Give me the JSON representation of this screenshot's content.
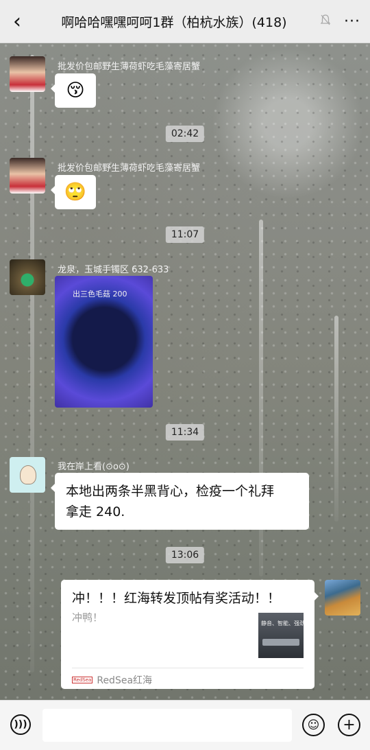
{
  "header": {
    "title": "啊哈哈嘿嘿呵呵1群（柏杭水族）(418)",
    "back_icon": "chevron-left-icon",
    "mute_icon": "bell-off-icon",
    "more_icon": "more-dots-icon"
  },
  "messages": [
    {
      "sender": "批发价包邮野生薄荷虾吃毛藻寄居蟹",
      "type": "emoji",
      "emoji": "😚"
    },
    {
      "timestamp": "02:42"
    },
    {
      "sender": "批发价包邮野生薄荷虾吃毛藻寄居蟹",
      "type": "emoji",
      "emoji": "🙄"
    },
    {
      "timestamp": "11:07"
    },
    {
      "sender": "龙泉，玉城手镯区 632-633",
      "type": "image",
      "image_caption": "出三色毛菇 200"
    },
    {
      "timestamp": "11:34"
    },
    {
      "sender": "我在岸上看(⊙o⊙)",
      "type": "text",
      "text_line1": "本地出两条半黑背心，检疫一个礼拜",
      "text_line2": "拿走 240."
    },
    {
      "timestamp": "13:06"
    },
    {
      "type": "link_card",
      "card_title": "冲！！！红海转发顶帖有奖活动！！",
      "card_desc": "冲鸭！",
      "thumb_text": "静音、智能、强劲",
      "source_logo": "RedSea",
      "source_name": "RedSea红海"
    }
  ],
  "footer": {
    "voice_icon": "voice-icon",
    "emoji_icon": "emoji-icon",
    "add_icon": "plus-icon"
  }
}
